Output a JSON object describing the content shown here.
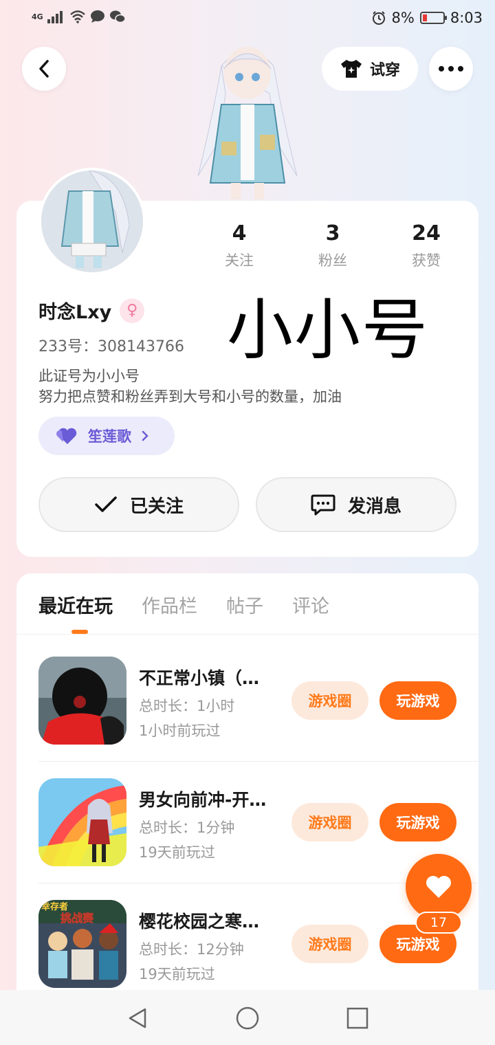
{
  "status_bar": {
    "network": "4G",
    "battery": "8%",
    "time": "8:03"
  },
  "header": {
    "try_on_label": "试穿"
  },
  "profile": {
    "name": "时念Lxy",
    "uid": "233号：308143766",
    "watermark": "小小号",
    "bio_line1": "此证号为小小号",
    "bio_line2": "努力把点赞和粉丝弄到大号和小号的数量，加油",
    "group_name": "笙莲歌",
    "stats": [
      {
        "num": "4",
        "label": "关注"
      },
      {
        "num": "3",
        "label": "粉丝"
      },
      {
        "num": "24",
        "label": "获赞"
      }
    ],
    "follow_label": "已关注",
    "message_label": "发消息"
  },
  "tabs": [
    {
      "label": "最近在玩",
      "active": true
    },
    {
      "label": "作品栏",
      "active": false
    },
    {
      "label": "帖子",
      "active": false
    },
    {
      "label": "评论",
      "active": false
    }
  ],
  "games": [
    {
      "title": "不正常小镇（…",
      "duration": "总时长：1小时",
      "last": "1小时前玩过",
      "circle": "游戏圈",
      "play": "玩游戏"
    },
    {
      "title": "男女向前冲-开…",
      "duration": "总时长：1分钟",
      "last": "19天前玩过",
      "circle": "游戏圈",
      "play": "玩游戏"
    },
    {
      "title": "樱花校园之寒…",
      "duration": "总时长：12分钟",
      "last": "19天前玩过",
      "circle": "游戏圈",
      "play": "玩游戏",
      "icon_text_1": "幸存者",
      "icon_text_2": "挑战赛"
    }
  ],
  "fab": {
    "count": "17"
  },
  "colors": {
    "accent": "#ff6a13",
    "chip_bg": "#fde9dc",
    "group_chip": "#6a5bd6"
  }
}
